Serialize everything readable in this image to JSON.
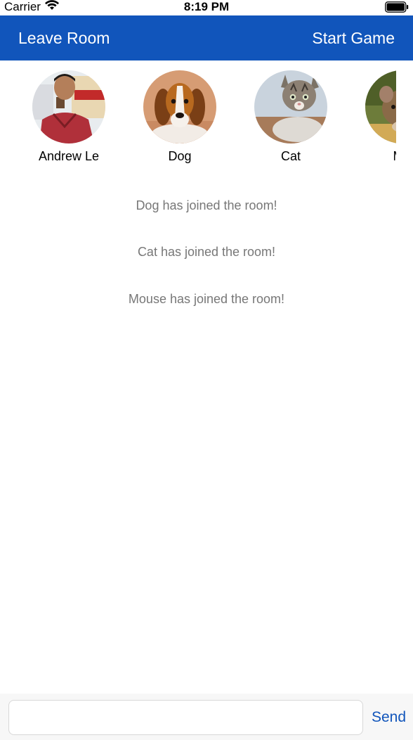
{
  "status_bar": {
    "carrier": "Carrier",
    "time": "8:19 PM",
    "battery_level": 1.0
  },
  "nav_bar": {
    "leave_label": "Leave Room",
    "start_label": "Start Game",
    "background_color": "#1155bb"
  },
  "players": [
    {
      "name": "Andrew Le",
      "avatar": "person-photo"
    },
    {
      "name": "Dog",
      "avatar": "beagle-photo"
    },
    {
      "name": "Cat",
      "avatar": "kitten-photo"
    },
    {
      "name": "Mo",
      "avatar": "mouse-photo"
    }
  ],
  "messages": [
    "Dog has joined the room!",
    "Cat has joined the room!",
    "Mouse has joined the room!"
  ],
  "input_bar": {
    "value": "",
    "send_label": "Send"
  }
}
